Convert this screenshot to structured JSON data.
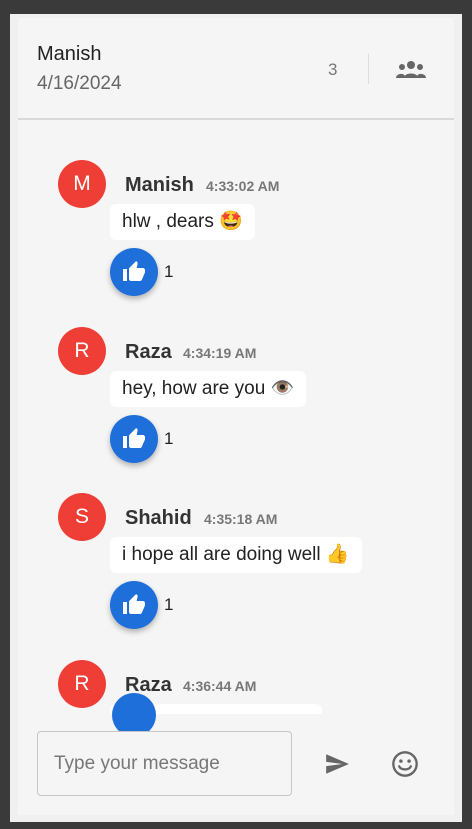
{
  "header": {
    "name": "Manish",
    "date": "4/16/2024",
    "member_count": "3",
    "icon": "group-icon"
  },
  "messages": [
    {
      "initial": "M",
      "sender": "Manish",
      "time": "4:33:02 AM",
      "text": "hlw , dears 🤩",
      "likes": "1"
    },
    {
      "initial": "R",
      "sender": "Raza",
      "time": "4:34:19 AM",
      "text": "hey, how are you 👁️",
      "likes": "1"
    },
    {
      "initial": "S",
      "sender": "Shahid",
      "time": "4:35:18 AM",
      "text": "i hope all are doing well 👍",
      "likes": "1"
    },
    {
      "initial": "R",
      "sender": "Raza",
      "time": "4:36:44 AM",
      "text": "",
      "likes": ""
    }
  ],
  "composer": {
    "placeholder": "Type your message",
    "send_icon": "send-icon",
    "emoji_icon": "emoji-icon"
  },
  "colors": {
    "avatar": "#ef3e36",
    "like": "#1e6fd9"
  }
}
